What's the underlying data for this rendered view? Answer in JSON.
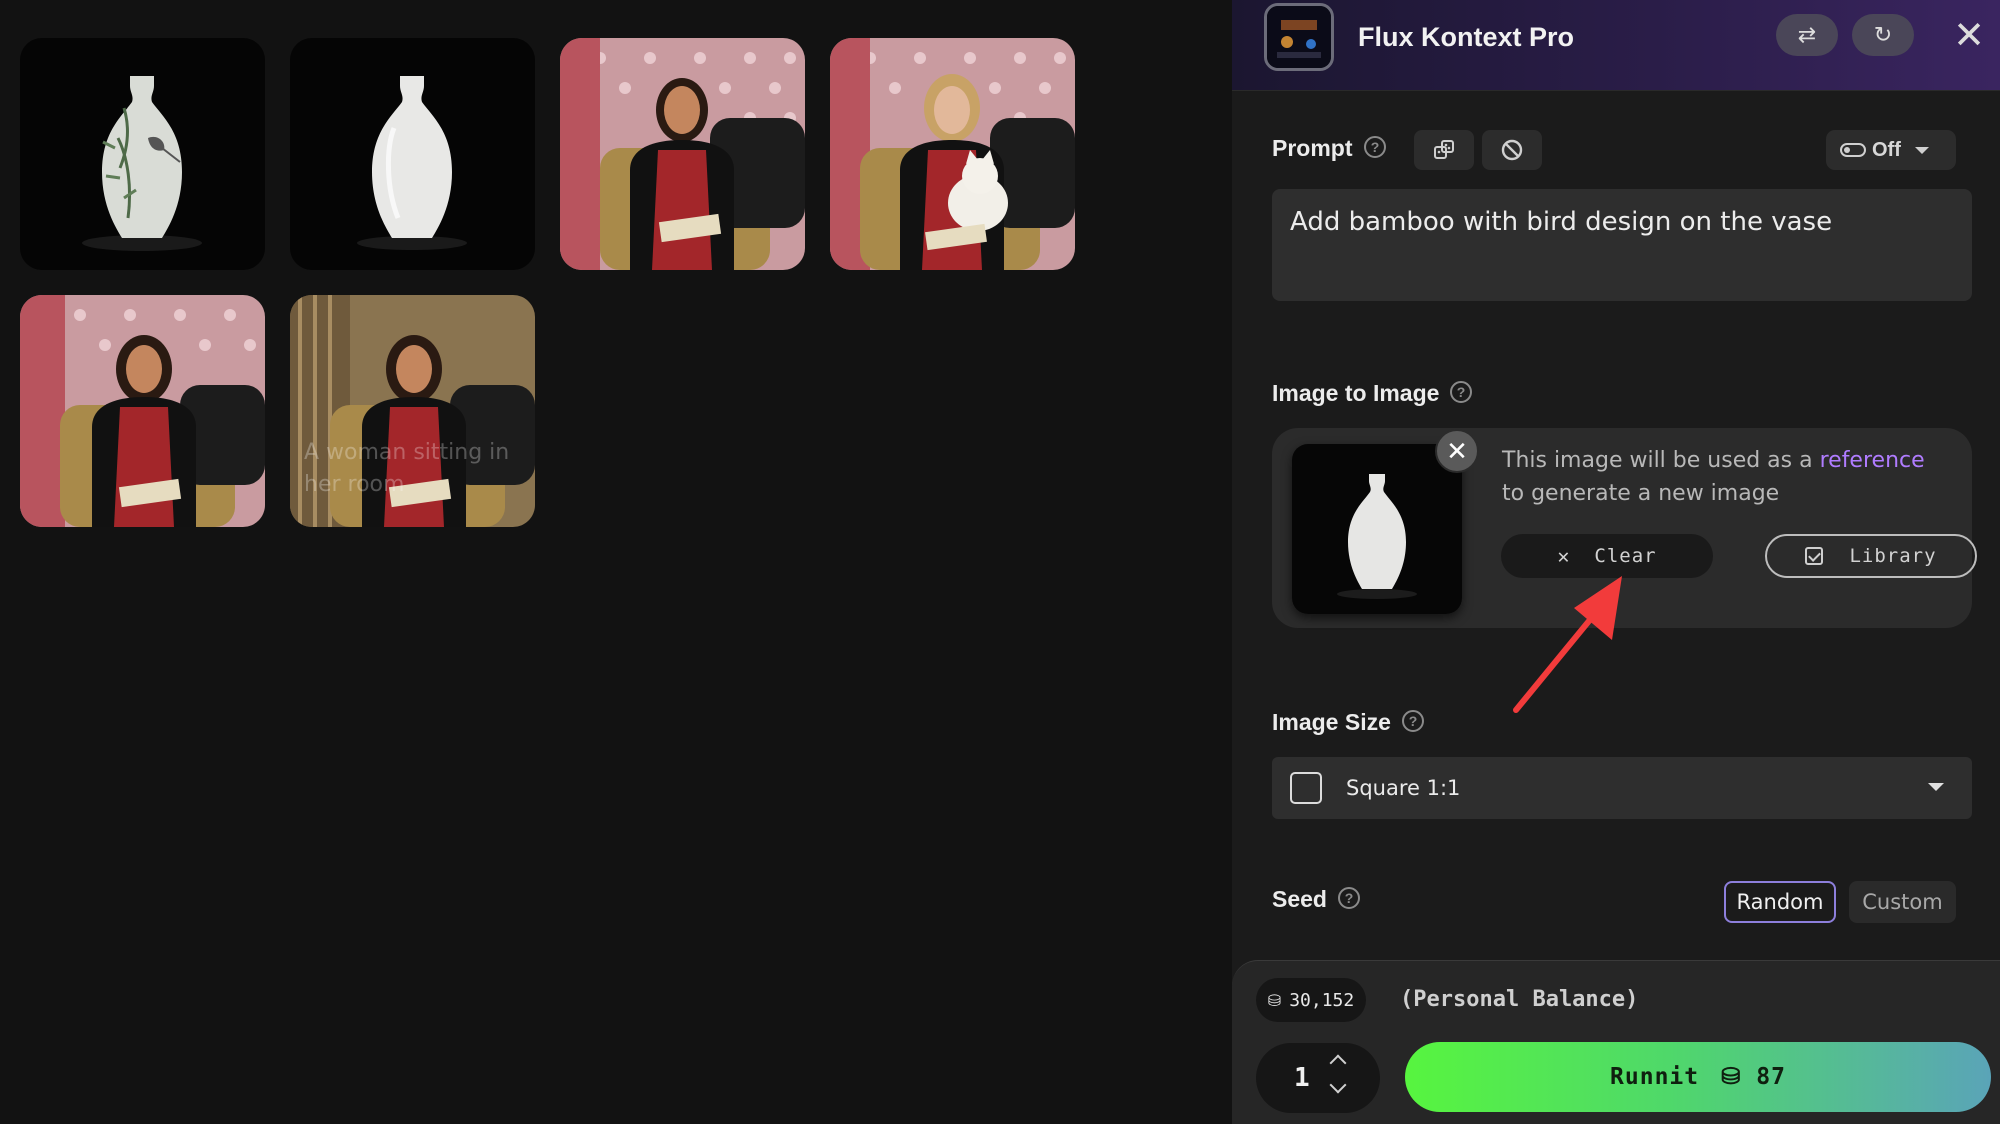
{
  "gallery": {
    "items": [
      {
        "subject": "vase with bamboo and bird design",
        "overlay": ""
      },
      {
        "subject": "plain white vase",
        "overlay": ""
      },
      {
        "subject": "woman sitting in armchair",
        "overlay": ""
      },
      {
        "subject": "woman with white cat in armchair",
        "overlay": ""
      },
      {
        "subject": "woman sitting in armchair",
        "overlay": ""
      },
      {
        "subject": "woman sitting in armchair",
        "overlay": "A woman sitting in her room"
      }
    ]
  },
  "header": {
    "title": "Flux Kontext Pro",
    "icons": [
      "app-thumbnail-icon",
      "swap-icon",
      "refresh-icon",
      "close-icon"
    ]
  },
  "prompt": {
    "label": "Prompt",
    "toggle_label": "Off",
    "value": "Add bamboo with bird design on the vase"
  },
  "image_to_image": {
    "label": "Image to Image",
    "description_before": "This image will be used as a ",
    "description_link": "reference",
    "description_after": " to generate a new image",
    "clear_label": "Clear",
    "library_label": "Library"
  },
  "image_size": {
    "label": "Image Size",
    "selected": "Square 1:1"
  },
  "seed": {
    "label": "Seed",
    "options": [
      "Random",
      "Custom"
    ],
    "selected": "Random"
  },
  "footer": {
    "balance": "30,152",
    "balance_label": "(Personal Balance)",
    "quantity": "1",
    "run_label": "Runnit",
    "run_cost": "87"
  },
  "colors": {
    "accent_purple": "#b07cff",
    "run_gradient_start": "#57f53f",
    "run_gradient_end": "#5aa4b8",
    "annotation_arrow": "#f23b3b"
  }
}
